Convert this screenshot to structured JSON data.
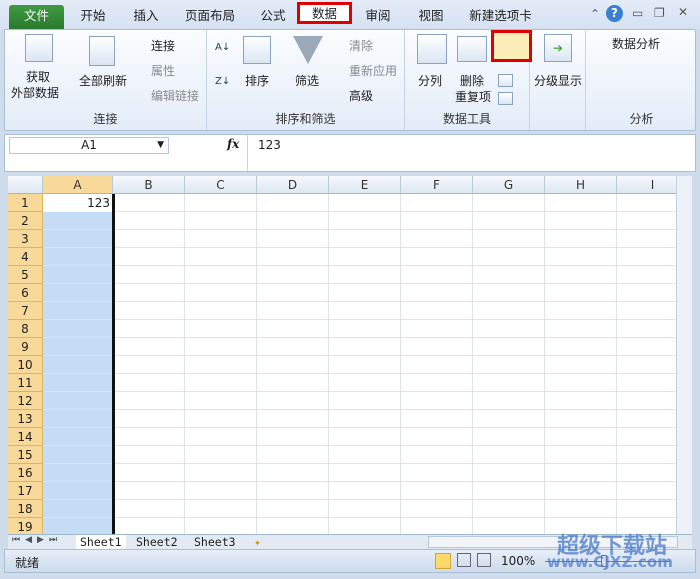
{
  "tabs": [
    "文件",
    "开始",
    "插入",
    "页面布局",
    "公式",
    "数据",
    "审阅",
    "视图",
    "新建选项卡"
  ],
  "ribbon": {
    "get_external": [
      "获取",
      "外部数据"
    ],
    "refresh_all": "全部刷新",
    "connections": "连接",
    "properties": "属性",
    "edit_links": "编辑链接",
    "group_connections": "连接",
    "sort": "排序",
    "filter": "筛选",
    "clear": "清除",
    "reapply": "重新应用",
    "advanced": "高级",
    "group_sort": "排序和筛选",
    "text_to_columns": "分列",
    "remove_dup": [
      "删除",
      "重复项"
    ],
    "group_tools": "数据工具",
    "outline": "分级显示",
    "data_analysis": "数据分析",
    "group_analysis": "分析"
  },
  "formula": {
    "name_box": "A1",
    "fx": "fx",
    "value": "123"
  },
  "grid": {
    "columns": [
      "A",
      "B",
      "C",
      "D",
      "E",
      "F",
      "G",
      "H",
      "I"
    ],
    "rows": 19,
    "cell_A1": "123"
  },
  "sheets": [
    "Sheet1",
    "Sheet2",
    "Sheet3"
  ],
  "status": {
    "ready": "就绪",
    "zoom": "100%"
  },
  "watermark": {
    "line1": "超级下载站",
    "line2": "www.CJXZ.com"
  },
  "colors": {
    "accent_red": "#e00000",
    "file_tab": "#2f8035",
    "selection": "#c5dcf5"
  }
}
